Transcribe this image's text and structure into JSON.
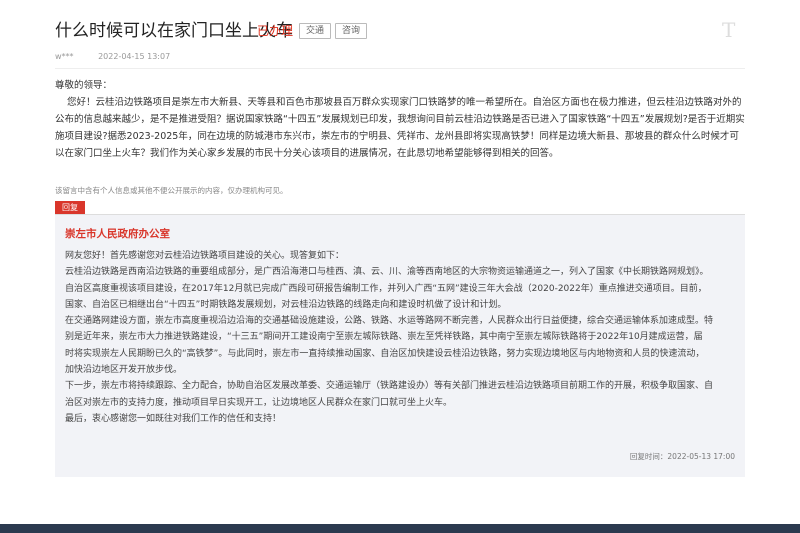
{
  "header": {
    "title": "什么时候可以在家门口坐上火车",
    "status": "已办理",
    "tags": [
      "交通",
      "咨询"
    ],
    "corner_text": "T"
  },
  "meta": {
    "author": "w***",
    "date": "2022-04-15 13:07"
  },
  "question": {
    "greeting": "尊敬的领导：",
    "body": "您好！云桂沿边铁路项目是崇左市大新县、天等县和百色市那坡县百万群众实现家门口铁路梦的唯一希望所在。自治区方面也在极力推进，但云桂沿边铁路对外的公布的信息越来越少，是不是推进受阻？据说国家铁路“十四五”发展规划已印发，我想询问目前云桂沿边铁路是否已进入了国家铁路“十四五”发展规划?是否于近期实施项目建设?据悉2023-2025年，同在边境的防城港市东兴市，崇左市的宁明县、凭祥市、龙州县即将实现高铁梦！同样是边境大新县、那坡县的群众什么时候才可以在家门口坐上火车？我们作为关心家乡发展的市民十分关心该项目的进展情况，在此恳切地希望能够得到相关的回答。"
  },
  "notice": "该留言中含有个人信息或其他不便公开展示的内容，仅办理机构可见。",
  "reply": {
    "tag": "回复",
    "org": "崇左市人民政府办公室",
    "lines": [
      "网友您好！首先感谢您对云桂沿边铁路项目建设的关心。现答复如下：",
      "云桂沿边铁路是西南沿边铁路的重要组成部分，是广西沿海港口与桂西、滇、云、川、渝等西南地区的大宗物资运输通道之一，列入了国家《中长期铁路网规划》。",
      "自治区高度重视该项目建设，在2017年12月就已完成广西段可研报告编制工作，并列入广西“五网”建设三年大会战（2020-2022年）重点推进交通项目。目前，",
      "国家、自治区已相继出台“十四五”时期铁路发展规划，对云桂沿边铁路的线路走向和建设时机做了设计和计划。",
      "在交通路网建设方面，崇左市高度重视沿边沿海的交通基础设施建设，公路、铁路、水运等路网不断完善，人民群众出行日益便捷，综合交通运输体系加速成型。特",
      "别是近年来，崇左市大力推进铁路建设，“十三五”期间开工建设南宁至崇左城际铁路、崇左至凭祥铁路，其中南宁至崇左城际铁路将于2022年10月建成运营，届",
      "时将实现崇左人民期盼已久的“高铁梦”。与此同时，崇左市一直持续推动国家、自治区加快建设云桂沿边铁路，努力实现边境地区与内地物资和人员的快速流动，",
      "加快沿边地区开发开放步伐。",
      "下一步，崇左市将持续跟踪、全力配合，协助自治区发展改革委、交通运输厅（铁路建设办）等有关部门推进云桂沿边铁路项目前期工作的开展，积极争取国家、自",
      "治区对崇左市的支持力度，推动项目早日实现开工，让边境地区人民群众在家门口就可坐上火车。",
      "最后，衷心感谢您一如既往对我们工作的信任和支持！"
    ],
    "time": "回复时间：2022-05-13 17:00"
  }
}
